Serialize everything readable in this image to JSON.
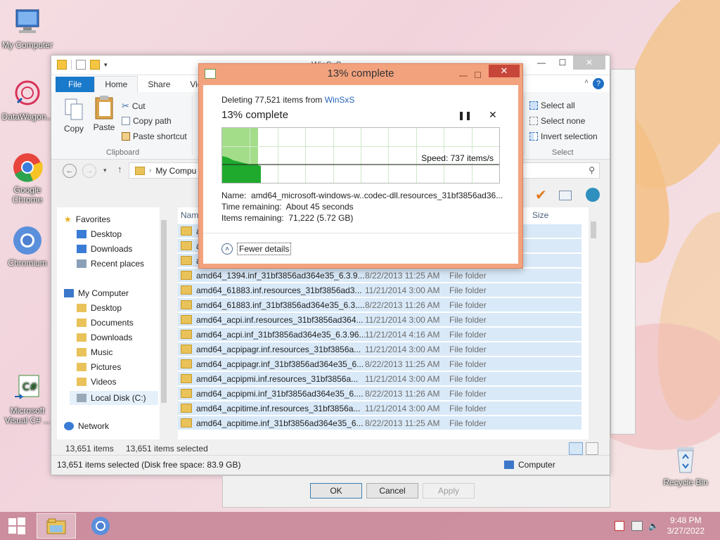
{
  "desktop": {
    "icons": [
      {
        "label": "My Computer"
      },
      {
        "label": "DataWagon..."
      },
      {
        "label": "Google Chrome"
      },
      {
        "label": "Chromium"
      },
      {
        "label": "Microsoft Visual C# ..."
      },
      {
        "label": "Recycle Bin"
      }
    ]
  },
  "explorer": {
    "title": "WinSxS",
    "tabs": [
      "File",
      "Home",
      "Share",
      "View"
    ],
    "clipboard": {
      "copy": "Copy",
      "paste": "Paste",
      "cut": "Cut",
      "copy_path": "Copy path",
      "paste_shortcut": "Paste shortcut",
      "group_label": "Clipboard"
    },
    "select": {
      "select_all": "Select all",
      "select_none": "Select none",
      "invert": "Invert selection",
      "group_label": "Select"
    },
    "address": "My Compu",
    "nav": {
      "favorites": "Favorites",
      "desktop": "Desktop",
      "downloads": "Downloads",
      "recent": "Recent places",
      "my_computer": "My Computer",
      "pc_desktop": "Desktop",
      "documents": "Documents",
      "pc_downloads": "Downloads",
      "music": "Music",
      "pictures": "Pictures",
      "videos": "Videos",
      "local_disk": "Local Disk (C:)",
      "network": "Network"
    },
    "columns": {
      "name": "Nam",
      "size": "Size"
    },
    "rows": [
      {
        "name": "amd",
        "date": "",
        "type": ""
      },
      {
        "name": "amd",
        "date": "",
        "type": ""
      },
      {
        "name": "amd",
        "date": "",
        "type": ""
      },
      {
        "name": "amd64_1394.inf_31bf3856ad364e35_6.3.9...",
        "date": "8/22/2013 11:25 AM",
        "type": "File folder"
      },
      {
        "name": "amd64_61883.inf.resources_31bf3856ad3...",
        "date": "11/21/2014 3:00 AM",
        "type": "File folder"
      },
      {
        "name": "amd64_61883.inf_31bf3856ad364e35_6.3....",
        "date": "8/22/2013 11:26 AM",
        "type": "File folder"
      },
      {
        "name": "amd64_acpi.inf.resources_31bf3856ad364...",
        "date": "11/21/2014 3:00 AM",
        "type": "File folder"
      },
      {
        "name": "amd64_acpi.inf_31bf3856ad364e35_6.3.96...",
        "date": "11/21/2014 4:16 AM",
        "type": "File folder"
      },
      {
        "name": "amd64_acpipagr.inf.resources_31bf3856a...",
        "date": "11/21/2014 3:00 AM",
        "type": "File folder"
      },
      {
        "name": "amd64_acpipagr.inf_31bf3856ad364e35_6...",
        "date": "8/22/2013 11:25 AM",
        "type": "File folder"
      },
      {
        "name": "amd64_acpipmi.inf.resources_31bf3856a...",
        "date": "11/21/2014 3:00 AM",
        "type": "File folder"
      },
      {
        "name": "amd64_acpipmi.inf_31bf3856ad364e35_6....",
        "date": "8/22/2013 11:26 AM",
        "type": "File folder"
      },
      {
        "name": "amd64_acpitime.inf.resources_31bf3856a...",
        "date": "11/21/2014 3:00 AM",
        "type": "File folder"
      },
      {
        "name": "amd64_acpitime.inf_31bf3856ad364e35_6...",
        "date": "8/22/2013 11:25 AM",
        "type": "File folder"
      }
    ],
    "status": {
      "items": "13,651 items",
      "selected": "13,651 items selected",
      "bottom": "13,651 items selected (Disk free space: 83.9 GB)",
      "location": "Computer"
    }
  },
  "dialog": {
    "title": "13% complete",
    "subtitle_prefix": "Deleting 77,521 items from ",
    "subtitle_link": "WinSxS",
    "percent_text": "13% complete",
    "progress": 0.13,
    "speed": "Speed: 737 items/s",
    "name_label": "Name:",
    "name_value": "amd64_microsoft-windows-w..codec-dll.resources_31bf3856ad36...",
    "time_label": "Time remaining:",
    "time_value": "About 45 seconds",
    "items_label": "Items remaining:",
    "items_value": "71,222 (5.72 GB)",
    "fewer_details": "Fewer details"
  },
  "behind_dialog": {
    "ok": "OK",
    "cancel": "Cancel",
    "apply": "Apply"
  },
  "taskbar": {
    "time": "9:48 PM",
    "date": "3/27/2022"
  }
}
